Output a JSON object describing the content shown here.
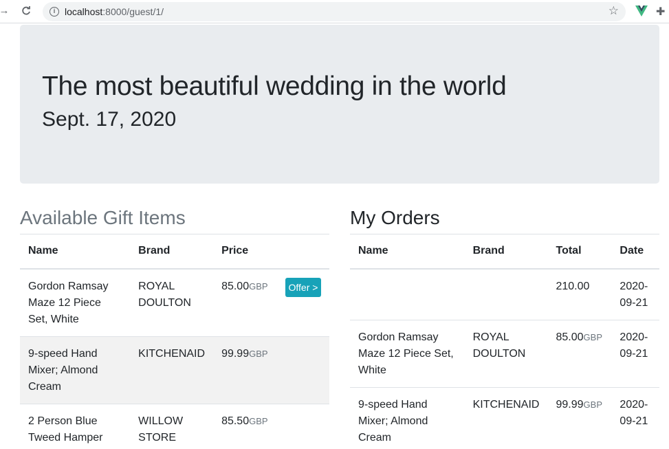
{
  "browser": {
    "url_host": "localhost",
    "url_path": ":8000/guest/1/",
    "back_icon": "arrow-right-icon",
    "reload_icon": "reload-icon",
    "info_icon": "info-icon",
    "star_icon": "star-icon",
    "vue_color": "#41b883"
  },
  "jumbotron": {
    "title": "The most beautiful wedding in the world",
    "date": "Sept. 17, 2020",
    "bg_color": "#e9ecef"
  },
  "gifts": {
    "heading": "Available Gift Items",
    "columns": [
      "Name",
      "Brand",
      "Price"
    ],
    "currency": "GBP",
    "offer_label": "Offer >",
    "rows": [
      {
        "name": "Gordon Ramsay Maze 12 Piece Set, White",
        "brand": "ROYAL DOULTON",
        "price": "85.00"
      },
      {
        "name": "9-speed Hand Mixer; Almond Cream",
        "brand": "KITCHENAID",
        "price": "99.99"
      },
      {
        "name": "2 Person Blue Tweed Hamper",
        "brand": "WILLOW STORE",
        "price": "85.50"
      }
    ]
  },
  "orders": {
    "heading": "My Orders",
    "columns": [
      "Name",
      "Brand",
      "Total",
      "Date"
    ],
    "currency": "GBP",
    "rows": [
      {
        "name": "",
        "brand": "",
        "total": "210.00",
        "currency": "",
        "date": "2020-09-21"
      },
      {
        "name": "Gordon Ramsay Maze 12 Piece Set, White",
        "brand": "ROYAL DOULTON",
        "total": "85.00",
        "currency": "GBP",
        "date": "2020-09-21"
      },
      {
        "name": "9-speed Hand Mixer; Almond Cream",
        "brand": "KITCHENAID",
        "total": "99.99",
        "currency": "GBP",
        "date": "2020-09-21"
      }
    ]
  },
  "colors": {
    "accent_button": "#17a2b8",
    "muted_text": "#6c757d"
  }
}
